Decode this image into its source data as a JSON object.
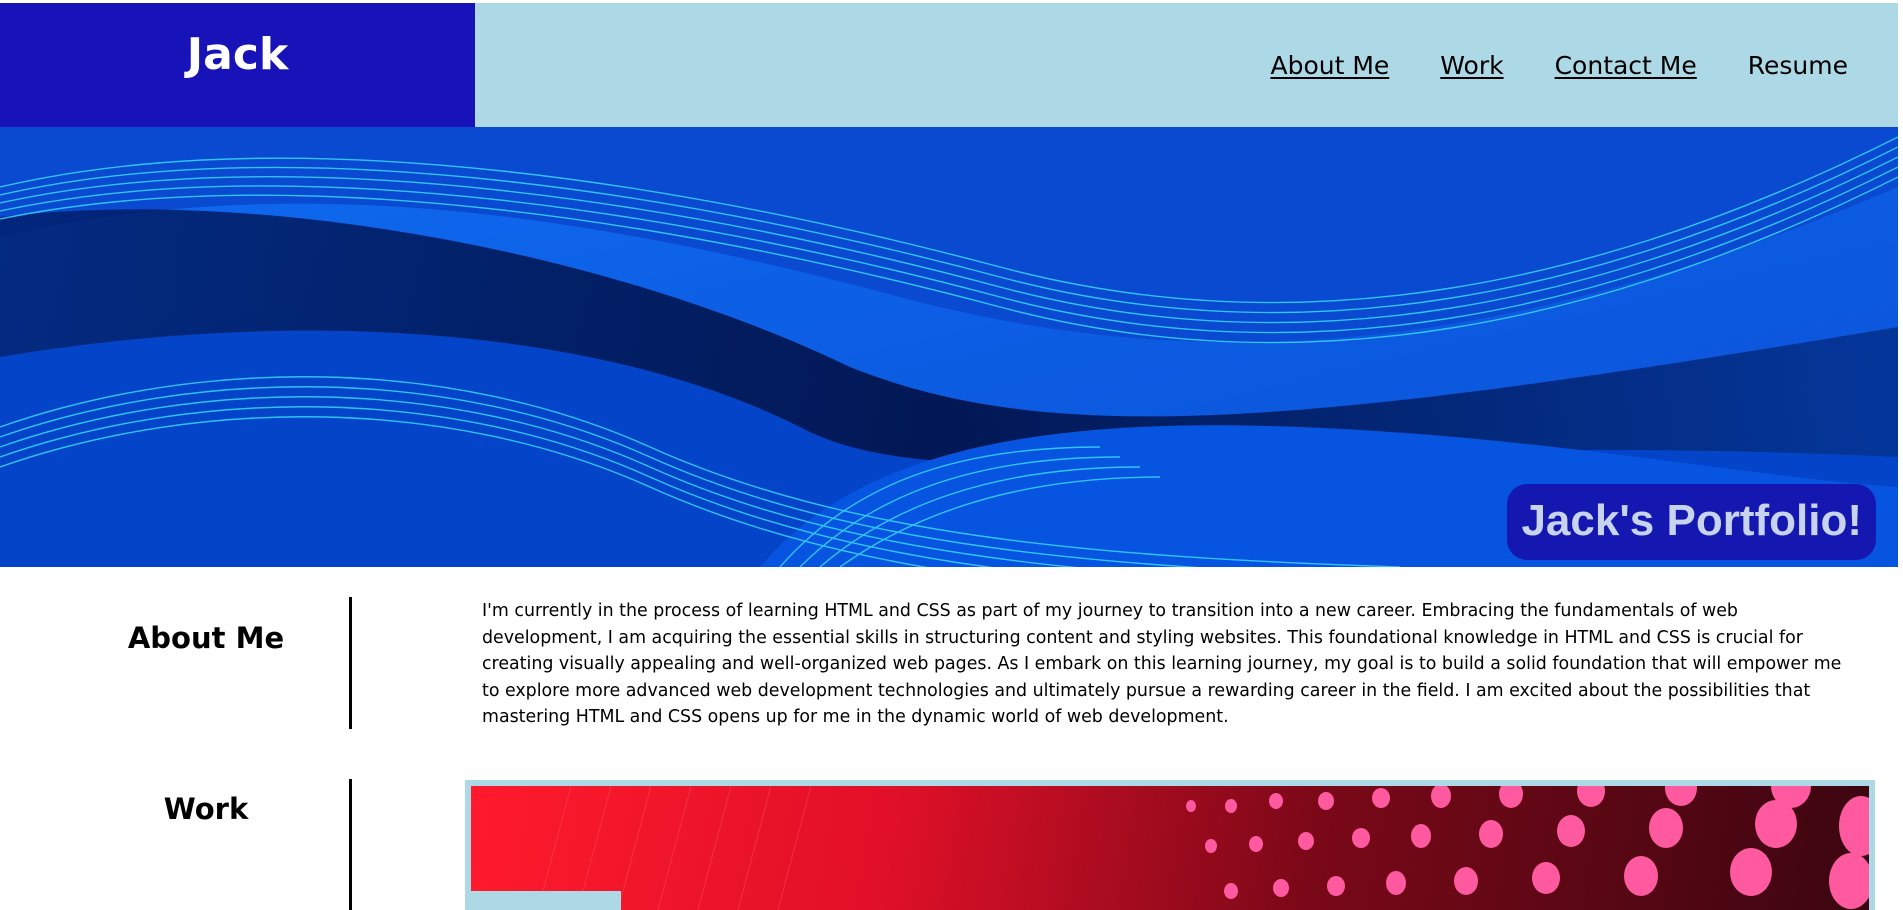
{
  "header": {
    "brand": "Jack",
    "nav": [
      {
        "label": "About Me"
      },
      {
        "label": "Work"
      },
      {
        "label": "Contact Me"
      },
      {
        "label": "Resume"
      }
    ]
  },
  "hero": {
    "title": "Jack's Portfolio!"
  },
  "about": {
    "heading": "About Me",
    "text": "I'm currently in the process of learning HTML and CSS as part of my journey to transition into a new career. Embracing the fundamentals of web development, I am acquiring the essential skills in structuring content and styling websites. This foundational knowledge in HTML and CSS is crucial for creating visually appealing and well-organized web pages. As I embark on this learning journey, my goal is to build a solid foundation that will empower me to explore more advanced web development technologies and ultimately pursue a rewarding career in the field. I am excited about the possibilities that mastering HTML and CSS opens up for me in the dynamic world of web development."
  },
  "work": {
    "heading": "Work"
  },
  "colors": {
    "brand_bg": "#1813b8",
    "header_bg": "#add8e6",
    "hero_title_bg": "#1418b0",
    "hero_title_text": "#c7d3ef"
  }
}
